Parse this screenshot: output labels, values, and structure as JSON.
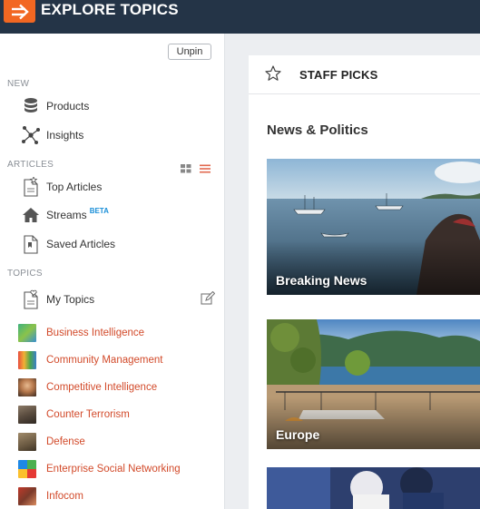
{
  "topbar": {
    "title": "EXPLORE TOPICS",
    "accent": "#f26722"
  },
  "sidebar": {
    "unpin_label": "Unpin",
    "sections": {
      "new": "NEW",
      "articles": "ARTICLES",
      "topics": "TOPICS"
    },
    "new_items": [
      {
        "label": "Products",
        "icon": "database-icon"
      },
      {
        "label": "Insights",
        "icon": "network-icon"
      }
    ],
    "article_items": [
      {
        "label": "Top Articles",
        "icon": "document-star-icon"
      },
      {
        "label": "Streams",
        "badge": "BETA",
        "icon": "home-icon"
      },
      {
        "label": "Saved Articles",
        "icon": "document-bookmark-icon"
      }
    ],
    "my_topics": {
      "label": "My Topics",
      "icon": "document-heart-icon"
    },
    "topics": [
      {
        "label": "Business Intelligence"
      },
      {
        "label": "Community Management"
      },
      {
        "label": "Competitive Intelligence"
      },
      {
        "label": "Counter Terrorism"
      },
      {
        "label": "Defense"
      },
      {
        "label": "Enterprise Social Networking"
      },
      {
        "label": "Infocom"
      }
    ]
  },
  "main": {
    "staff_picks": "STAFF PICKS",
    "section_title": "News & Politics",
    "cards": [
      {
        "label": "Breaking News"
      },
      {
        "label": "Europe"
      },
      {
        "label": ""
      }
    ]
  }
}
